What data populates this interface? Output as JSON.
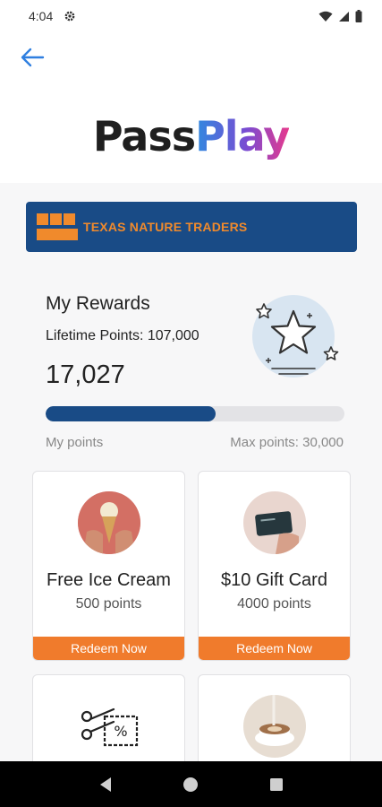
{
  "status_bar": {
    "time": "4:04"
  },
  "header": {
    "logo_left": "Pass",
    "logo_right": "Play"
  },
  "brand": {
    "name": "TEXAS NATURE TRADERS",
    "logo_text": "TEXAS NATURE TRADERS"
  },
  "rewards": {
    "title": "My Rewards",
    "lifetime_label": "Lifetime Points: 107,000",
    "points": "17,027",
    "progress_fraction": 0.5676,
    "my_points_label": "My points",
    "max_points_label": "Max points: 30,000"
  },
  "cards": [
    {
      "title": "Free Ice Cream",
      "points": "500 points",
      "button": "Redeem Now",
      "icon": "ice-cream-photo"
    },
    {
      "title": "$10 Gift Card",
      "points": "4000 points",
      "button": "Redeem Now",
      "icon": "gift-card-photo"
    },
    {
      "title": "",
      "points": "",
      "button": "",
      "icon": "coupon-scissors-icon"
    },
    {
      "title": "",
      "points": "",
      "button": "",
      "icon": "coffee-photo"
    }
  ],
  "colors": {
    "brand_blue": "#194b86",
    "accent_orange": "#f07b2c",
    "back_arrow": "#2f7fe0"
  }
}
